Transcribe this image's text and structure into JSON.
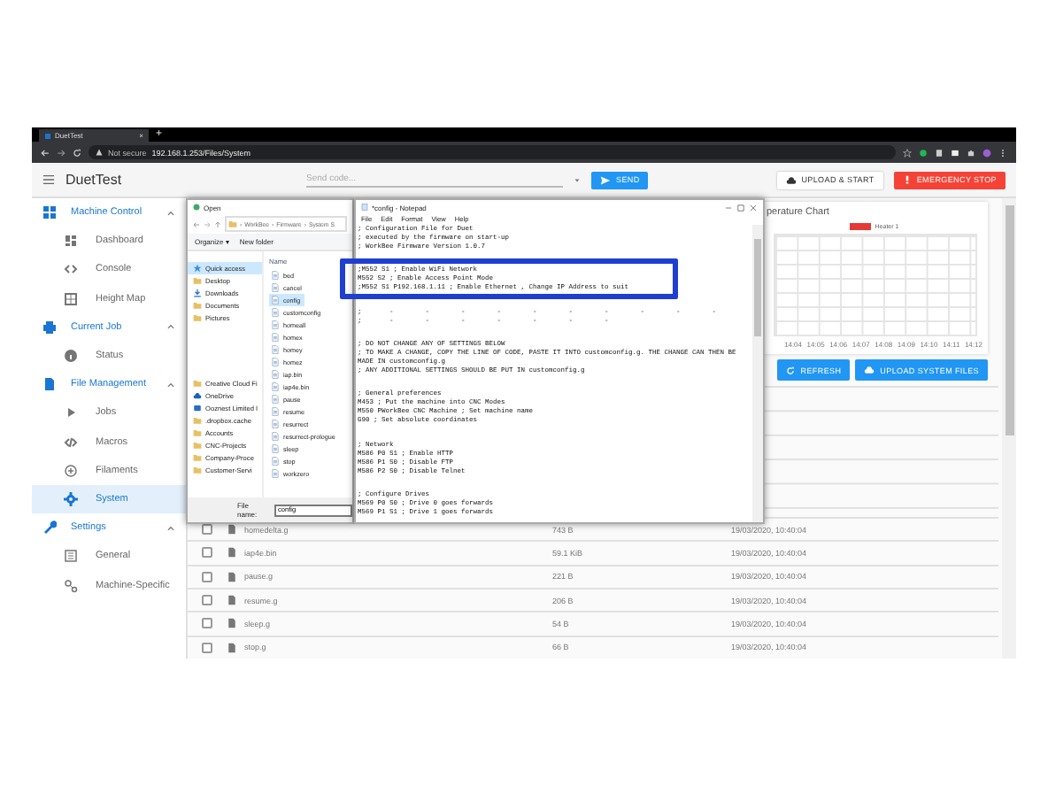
{
  "browser": {
    "tab_title": "DuetTest",
    "tab_close": "×",
    "new_tab": "+",
    "security": "Not secure",
    "url": "192.168.1.253/Files/System"
  },
  "app_bar": {
    "title": "DuetTest",
    "code_placeholder": "Send code...",
    "send": "SEND",
    "upload_start": "UPLOAD & START",
    "emergency_stop": "EMERGENCY STOP"
  },
  "sidebar": [
    {
      "label": "Machine Control",
      "expanded": true,
      "children": [
        {
          "label": "Dashboard",
          "selected": false
        },
        {
          "label": "Console",
          "selected": false
        },
        {
          "label": "Height Map",
          "selected": false
        }
      ]
    },
    {
      "label": "Current Job",
      "expanded": true,
      "children": [
        {
          "label": "Status",
          "selected": false
        }
      ]
    },
    {
      "label": "File Management",
      "expanded": true,
      "children": [
        {
          "label": "Jobs",
          "selected": false
        },
        {
          "label": "Macros",
          "selected": false
        },
        {
          "label": "Filaments",
          "selected": false
        },
        {
          "label": "System",
          "selected": true
        }
      ]
    },
    {
      "label": "Settings",
      "expanded": true,
      "children": [
        {
          "label": "General",
          "selected": false
        },
        {
          "label": "Machine-Specific",
          "selected": false
        }
      ]
    }
  ],
  "chart": {
    "title": "perature Chart",
    "legend": {
      "label": "Heater 1",
      "color": "#e53935"
    },
    "x_labels": [
      "14:04",
      "14:05",
      "14:06",
      "14:07",
      "14:08",
      "14:09",
      "14:10",
      "14:11",
      "14:12"
    ]
  },
  "file_buttons": [
    "REFRESH",
    "UPLOAD SYSTEM FILES"
  ],
  "files": [
    {
      "name": "homedelta.g",
      "size": "743 B",
      "date": "19/03/2020, 10:40:04",
      "checked": false
    },
    {
      "name": "iap4e.bin",
      "size": "59.1 KiB",
      "date": "19/03/2020, 10:40:04",
      "checked": false
    },
    {
      "name": "pause.g",
      "size": "221 B",
      "date": "19/03/2020, 10:40:04",
      "checked": false
    },
    {
      "name": "resume.g",
      "size": "206 B",
      "date": "19/03/2020, 10:40:04",
      "checked": false
    },
    {
      "name": "sleep.g",
      "size": "54 B",
      "date": "19/03/2020, 10:40:04",
      "checked": false
    },
    {
      "name": "stop.g",
      "size": "66 B",
      "date": "19/03/2020, 10:40:04",
      "checked": false
    }
  ],
  "open_dialog": {
    "title": "Open",
    "path": [
      {
        "sep": "›",
        "label": "WorkBee"
      },
      {
        "sep": "›",
        "label": "Firmware"
      },
      {
        "sep": "›",
        "label": "System S"
      }
    ],
    "organize": "Organize ▾",
    "new_folder": "New folder",
    "header": "Name",
    "nav": [
      {
        "label": "Quick access",
        "kind": "star",
        "selected": true
      },
      {
        "label": "Desktop",
        "kind": "folder",
        "selected": false
      },
      {
        "label": "Downloads",
        "kind": "download",
        "selected": false
      },
      {
        "label": "Documents",
        "kind": "folder",
        "selected": false
      },
      {
        "label": "Pictures",
        "kind": "folder",
        "selected": false
      },
      {
        "label": "Creative Cloud Fi",
        "kind": "folder",
        "selected": false
      },
      {
        "label": "OneDrive",
        "kind": "cloud",
        "selected": false
      },
      {
        "label": "Ooznest Limited I",
        "kind": "drive",
        "selected": false
      },
      {
        "label": ".dropbox.cache",
        "kind": "folder",
        "selected": false
      },
      {
        "label": "Accounts",
        "kind": "folder",
        "selected": false
      },
      {
        "label": "CNC-Projects",
        "kind": "folder",
        "selected": false
      },
      {
        "label": "Company-Proce",
        "kind": "folder",
        "selected": false
      },
      {
        "label": "Customer-Servi",
        "kind": "folder",
        "selected": false
      }
    ],
    "files": [
      {
        "name": "bed",
        "selected": false
      },
      {
        "name": "cancel",
        "selected": false
      },
      {
        "name": "config",
        "selected": true
      },
      {
        "name": "customconfig",
        "selected": false
      },
      {
        "name": "homeall",
        "selected": false
      },
      {
        "name": "homex",
        "selected": false
      },
      {
        "name": "homey",
        "selected": false
      },
      {
        "name": "homez",
        "selected": false
      },
      {
        "name": "iap.bin",
        "selected": false
      },
      {
        "name": "iap4e.bin",
        "selected": false
      },
      {
        "name": "pause",
        "selected": false
      },
      {
        "name": "resume",
        "selected": false
      },
      {
        "name": "resurrect",
        "selected": false
      },
      {
        "name": "resurrect-prologue",
        "selected": false
      },
      {
        "name": "sleep",
        "selected": false
      },
      {
        "name": "stop",
        "selected": false
      },
      {
        "name": "workzero",
        "selected": false
      }
    ],
    "file_name_label": "File name:",
    "file_name": "config"
  },
  "notepad": {
    "title": "*config - Notepad",
    "menu": [
      "File",
      "Edit",
      "Format",
      "View",
      "Help"
    ],
    "blocks": [
      [
        "; Configuration File for Duet",
        "; executed by the firmware on start-up",
        "; WorkBee Firmware Version 1.0.7"
      ],
      [
        ";M552 S1 ; Enable WiFi Network",
        "M552 S2 ; Enable Access Point Mode",
        ";M552 S1 P192.168.1.11 ; Enable Ethernet , Change IP Address to suit"
      ],
      [
        ";       -        -        -        -        -        -        -        -        -        -",
        ";       -        -        -        -        -        -        -"
      ],
      [
        "; DO NOT CHANGE ANY OF SETTINGS BELOW",
        "; TO MAKE A CHANGE, COPY THE LINE OF CODE, PASTE IT INTO customconfig.g. THE CHANGE CAN THEN BE",
        "MADE IN customconfig.g",
        "; ANY ADDITIONAL SETTINGS SHOULD BE PUT IN customconfig.g"
      ],
      [
        "; General preferences",
        "M453 ; Put the machine into CNC Modes",
        "M550 PWorkBee CNC Machine ; Set machine name",
        "G90 ; Set absolute coordinates"
      ],
      [
        "; Network",
        "M586 P0 S1 ; Enable HTTP",
        "M586 P1 S0 ; Disable FTP",
        "M586 P2 S0 ; Disable Telnet"
      ],
      [
        "; Configure Drives",
        "M569 P0 S0 ; Drive 0 goes forwards",
        "M569 P1 S1 ; Drive 1 goes forwards"
      ]
    ]
  }
}
